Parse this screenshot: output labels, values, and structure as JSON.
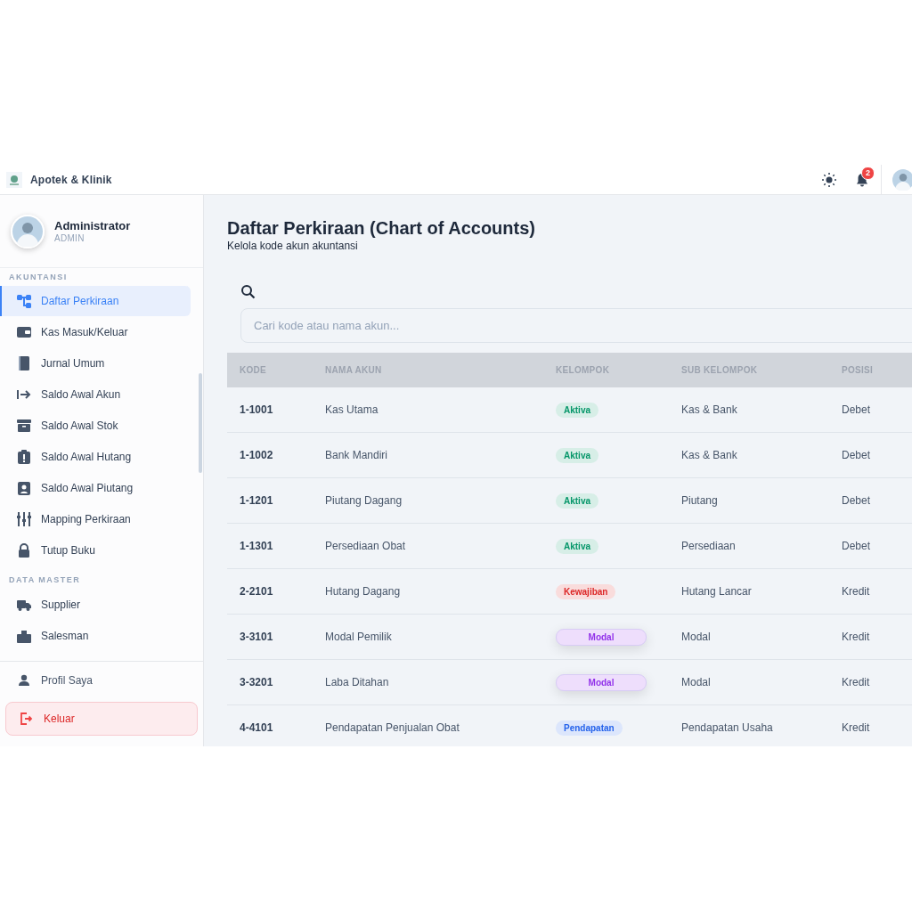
{
  "header": {
    "app_name": "Apotek & Klinik",
    "notification_count": "2"
  },
  "user": {
    "name": "Administrator",
    "role": "ADMIN"
  },
  "sidebar": {
    "sections": [
      {
        "label": "AKUNTANSI",
        "items": [
          {
            "label": "Daftar Perkiraan",
            "selected": true
          },
          {
            "label": "Kas Masuk/Keluar",
            "selected": false
          },
          {
            "label": "Jurnal Umum",
            "selected": false
          },
          {
            "label": "Saldo Awal Akun",
            "selected": false
          },
          {
            "label": "Saldo Awal Stok",
            "selected": false
          },
          {
            "label": "Saldo Awal Hutang",
            "selected": false
          },
          {
            "label": "Saldo Awal Piutang",
            "selected": false
          },
          {
            "label": "Mapping Perkiraan",
            "selected": false
          },
          {
            "label": "Tutup Buku",
            "selected": false
          }
        ]
      },
      {
        "label": "DATA MASTER",
        "items": [
          {
            "label": "Supplier",
            "selected": false
          },
          {
            "label": "Salesman",
            "selected": false
          }
        ]
      }
    ],
    "footer": [
      {
        "label": "Profil Saya",
        "kind": "profile"
      },
      {
        "label": "Keluar",
        "kind": "logout"
      }
    ]
  },
  "page": {
    "title": "Daftar Perkiraan (Chart of Accounts)",
    "subtitle": "Kelola kode akun akuntansi"
  },
  "search": {
    "placeholder": "Cari kode atau nama akun..."
  },
  "table": {
    "columns": [
      "KODE",
      "NAMA AKUN",
      "KELOMPOK",
      "SUB KELOMPOK",
      "POSISI"
    ],
    "rows": [
      {
        "kode": "1-1001",
        "nama": "Kas Utama",
        "kelompok": {
          "label": "Aktiva",
          "color": "#059669",
          "kind": "plain"
        },
        "sub": "Kas & Bank",
        "posisi": "Debet"
      },
      {
        "kode": "1-1002",
        "nama": "Bank Mandiri",
        "kelompok": {
          "label": "Aktiva",
          "color": "#059669",
          "kind": "plain"
        },
        "sub": "Kas & Bank",
        "posisi": "Debet"
      },
      {
        "kode": "1-1201",
        "nama": "Piutang Dagang",
        "kelompok": {
          "label": "Aktiva",
          "color": "#059669",
          "kind": "plain"
        },
        "sub": "Piutang",
        "posisi": "Debet"
      },
      {
        "kode": "1-1301",
        "nama": "Persediaan Obat",
        "kelompok": {
          "label": "Aktiva",
          "color": "#059669",
          "kind": "plain"
        },
        "sub": "Persediaan",
        "posisi": "Debet"
      },
      {
        "kode": "2-2101",
        "nama": "Hutang Dagang",
        "kelompok": {
          "label": "Kewajiban",
          "color": "#dc2626",
          "kind": "plain"
        },
        "sub": "Hutang Lancar",
        "posisi": "Kredit"
      },
      {
        "kode": "3-3101",
        "nama": "Modal Pemilik",
        "kelompok": {
          "label": "Modal",
          "color": "#9333ea",
          "kind": "raised"
        },
        "sub": "Modal",
        "posisi": "Kredit"
      },
      {
        "kode": "3-3201",
        "nama": "Laba Ditahan",
        "kelompok": {
          "label": "Modal",
          "color": "#9333ea",
          "kind": "raised"
        },
        "sub": "Modal",
        "posisi": "Kredit"
      },
      {
        "kode": "4-4101",
        "nama": "Pendapatan Penjualan Obat",
        "kelompok": {
          "label": "Pendapatan",
          "color": "#2563eb",
          "kind": "plain"
        },
        "sub": "Pendapatan Usaha",
        "posisi": "Kredit"
      }
    ]
  }
}
